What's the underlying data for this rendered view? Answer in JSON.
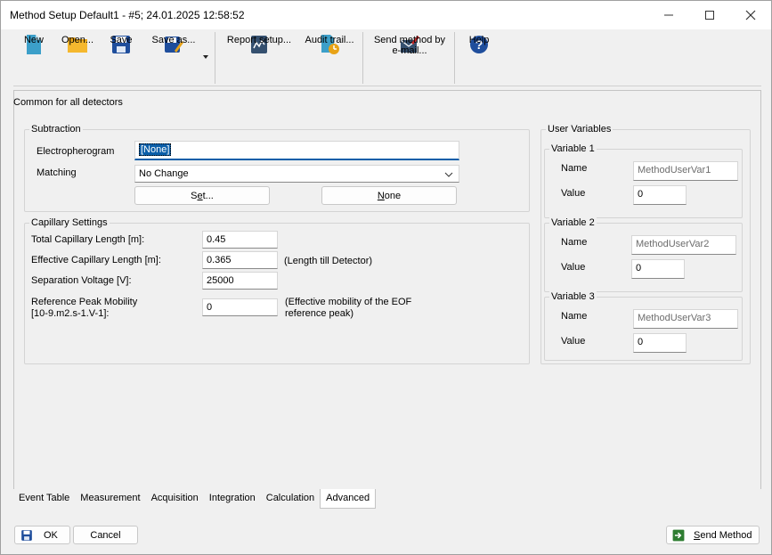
{
  "window": {
    "title": "Method Setup Default1 - #5;   24.01.2025   12:58:52",
    "minimize_icon": "minimize-icon",
    "maximize_icon": "maximize-icon",
    "close_icon": "close-icon"
  },
  "toolbar": {
    "new": "New",
    "open": "Open...",
    "save": "Save",
    "save_as": "Save as...",
    "report_setup": "Report setup...",
    "audit_trail": "Audit trail...",
    "send_email_line1": "Send method by",
    "send_email_line2": "e-mail...",
    "help": "Help"
  },
  "panel": {
    "heading": "Common for all detectors"
  },
  "subtraction": {
    "title": "Subtraction",
    "electropherogram_label": "Electropherogram",
    "electropherogram_value": "[None]",
    "matching_label": "Matching",
    "matching_value": "No Change",
    "set_button_pre": "S",
    "set_button_under": "e",
    "set_button_post": "t...",
    "none_button_pre": "",
    "none_button_under": "N",
    "none_button_post": "one"
  },
  "capillary": {
    "title": "Capillary Settings",
    "total_length_label": "Total Capillary Length [m]:",
    "total_length_value": "0.45",
    "effective_length_label": "Effective Capillary Length [m]:",
    "effective_length_value": "0.365",
    "effective_length_note": "(Length till Detector)",
    "voltage_label": "Separation Voltage [V]:",
    "voltage_value": "25000",
    "mobility_label_line1": "Reference Peak Mobility",
    "mobility_label_line2": "[10-9.m2.s-1.V-1]:",
    "mobility_value": "0",
    "mobility_note_line1": "(Effective mobility of the EOF",
    "mobility_note_line2": "reference peak)"
  },
  "user_variables": {
    "title": "User Variables",
    "variables": [
      {
        "title": "Variable 1",
        "name_label": "Name",
        "name_value": "MethodUserVar1",
        "value_label": "Value",
        "value": "0"
      },
      {
        "title": "Variable 2",
        "name_label": "Name",
        "name_value": "MethodUserVar2",
        "value_label": "Value",
        "value": "0"
      },
      {
        "title": "Variable 3",
        "name_label": "Name",
        "name_value": "MethodUserVar3",
        "value_label": "Value",
        "value": "0"
      }
    ]
  },
  "tabs": [
    "Event Table",
    "Measurement",
    "Acquisition",
    "Integration",
    "Calculation",
    "Advanced"
  ],
  "active_tab": "Advanced",
  "footer": {
    "ok": "OK",
    "cancel": "Cancel",
    "send_method_under": "S",
    "send_method_post": "end Method"
  }
}
